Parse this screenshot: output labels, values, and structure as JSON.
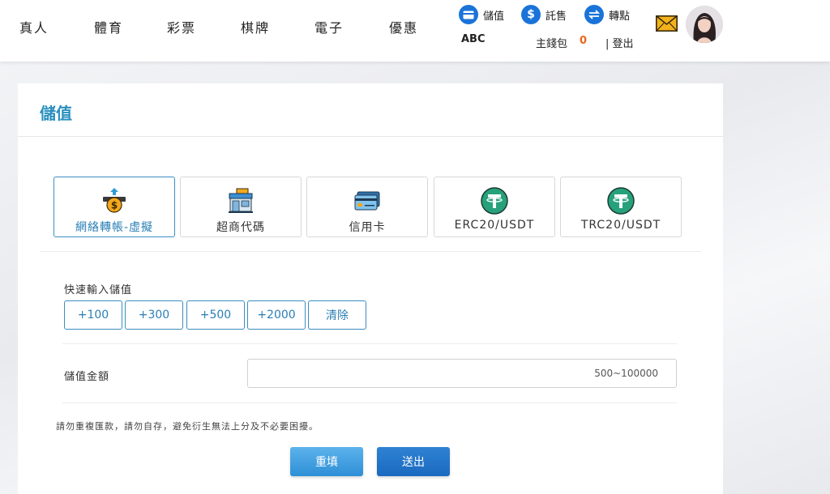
{
  "nav": {
    "items": [
      "真人",
      "體育",
      "彩票",
      "棋牌",
      "電子",
      "優惠"
    ]
  },
  "header_actions": {
    "deposit": "儲值",
    "withdraw": "託售",
    "transfer": "轉點"
  },
  "user": {
    "name": "ABC",
    "wallet_label": "主錢包",
    "wallet_value": "0",
    "logout": "| 登出"
  },
  "icons": {
    "deposit": "card-icon",
    "withdraw": "dollar-icon",
    "transfer": "transfer-arrows-icon",
    "mail": "envelope-icon"
  },
  "panel": {
    "title": "儲值"
  },
  "methods": [
    {
      "label": "網絡轉帳-虛擬",
      "icon": "bank-deposit-icon",
      "active": true
    },
    {
      "label": "超商代碼",
      "icon": "store-icon",
      "active": false
    },
    {
      "label": "信用卡",
      "icon": "credit-card-icon",
      "active": false
    },
    {
      "label": "ERC20/USDT",
      "icon": "tether-icon",
      "active": false
    },
    {
      "label": "TRC20/USDT",
      "icon": "tether-icon",
      "active": false
    }
  ],
  "quick": {
    "label": "快速輸入儲值",
    "buttons": [
      "+100",
      "+300",
      "+500",
      "+2000",
      "清除"
    ]
  },
  "amount": {
    "label": "儲值金額",
    "placeholder": "500~100000",
    "value": ""
  },
  "notice": "請勿重複匯款，請勿自存，避免衍生無法上分及不必要困擾。",
  "buttons": {
    "reset": "重填",
    "submit": "送出"
  },
  "colors": {
    "accent": "#2a8fbf",
    "primary_button": "#1a6ac0",
    "wallet_value": "#e8671c",
    "tether": "#26a17b"
  }
}
